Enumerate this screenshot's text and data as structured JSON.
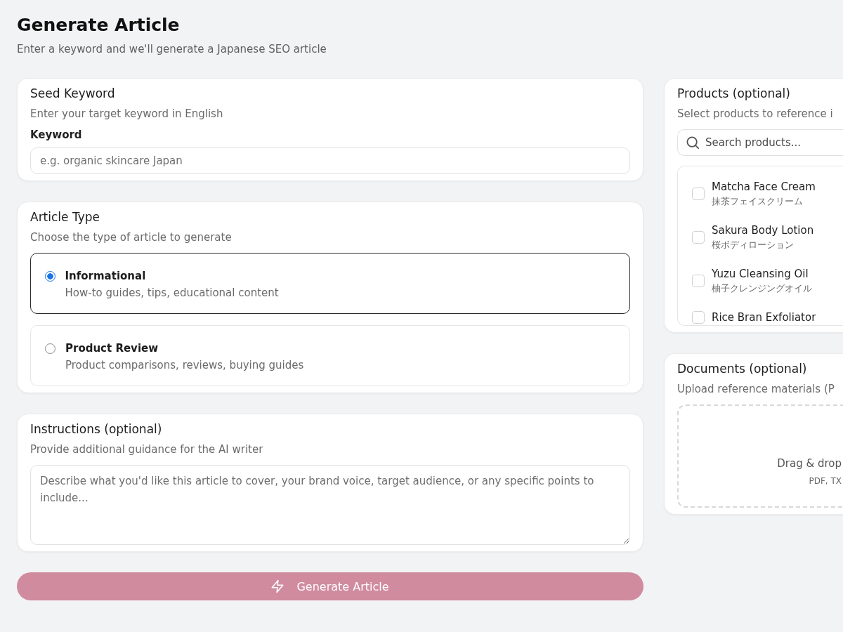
{
  "header": {
    "title": "Generate Article",
    "subtitle": "Enter a keyword and we'll generate a Japanese SEO article"
  },
  "seed_keyword": {
    "title": "Seed Keyword",
    "description": "Enter your target keyword in English",
    "field_label": "Keyword",
    "placeholder": "e.g. organic skincare Japan"
  },
  "article_type": {
    "title": "Article Type",
    "description": "Choose the type of article to generate",
    "options": [
      {
        "label": "Informational",
        "description": "How-to guides, tips, educational content",
        "selected": true
      },
      {
        "label": "Product Review",
        "description": "Product comparisons, reviews, buying guides",
        "selected": false
      }
    ]
  },
  "instructions": {
    "title": "Instructions (optional)",
    "description": "Provide additional guidance for the AI writer",
    "placeholder": "Describe what you'd like this article to cover, your brand voice, target audience, or any specific points to include..."
  },
  "generate_button": {
    "label": "Generate Article",
    "disabled": true
  },
  "products": {
    "title": "Products (optional)",
    "description": "Select products to reference i",
    "search": {
      "placeholder": "Search products..."
    },
    "items": [
      {
        "name": "Matcha Face Cream",
        "name_ja": "抹茶フェイスクリーム",
        "checked": false
      },
      {
        "name": "Sakura Body Lotion",
        "name_ja": "桜ボディローション",
        "checked": false
      },
      {
        "name": "Yuzu Cleansing Oil",
        "name_ja": "柚子クレンジングオイル",
        "checked": false
      },
      {
        "name": "Rice Bran Exfoliator",
        "checked": false
      }
    ]
  },
  "documents": {
    "title": "Documents (optional)",
    "description": "Upload reference materials (P",
    "drop_zone": {
      "text": "Drag & drop",
      "formats": "PDF, TX"
    }
  }
}
